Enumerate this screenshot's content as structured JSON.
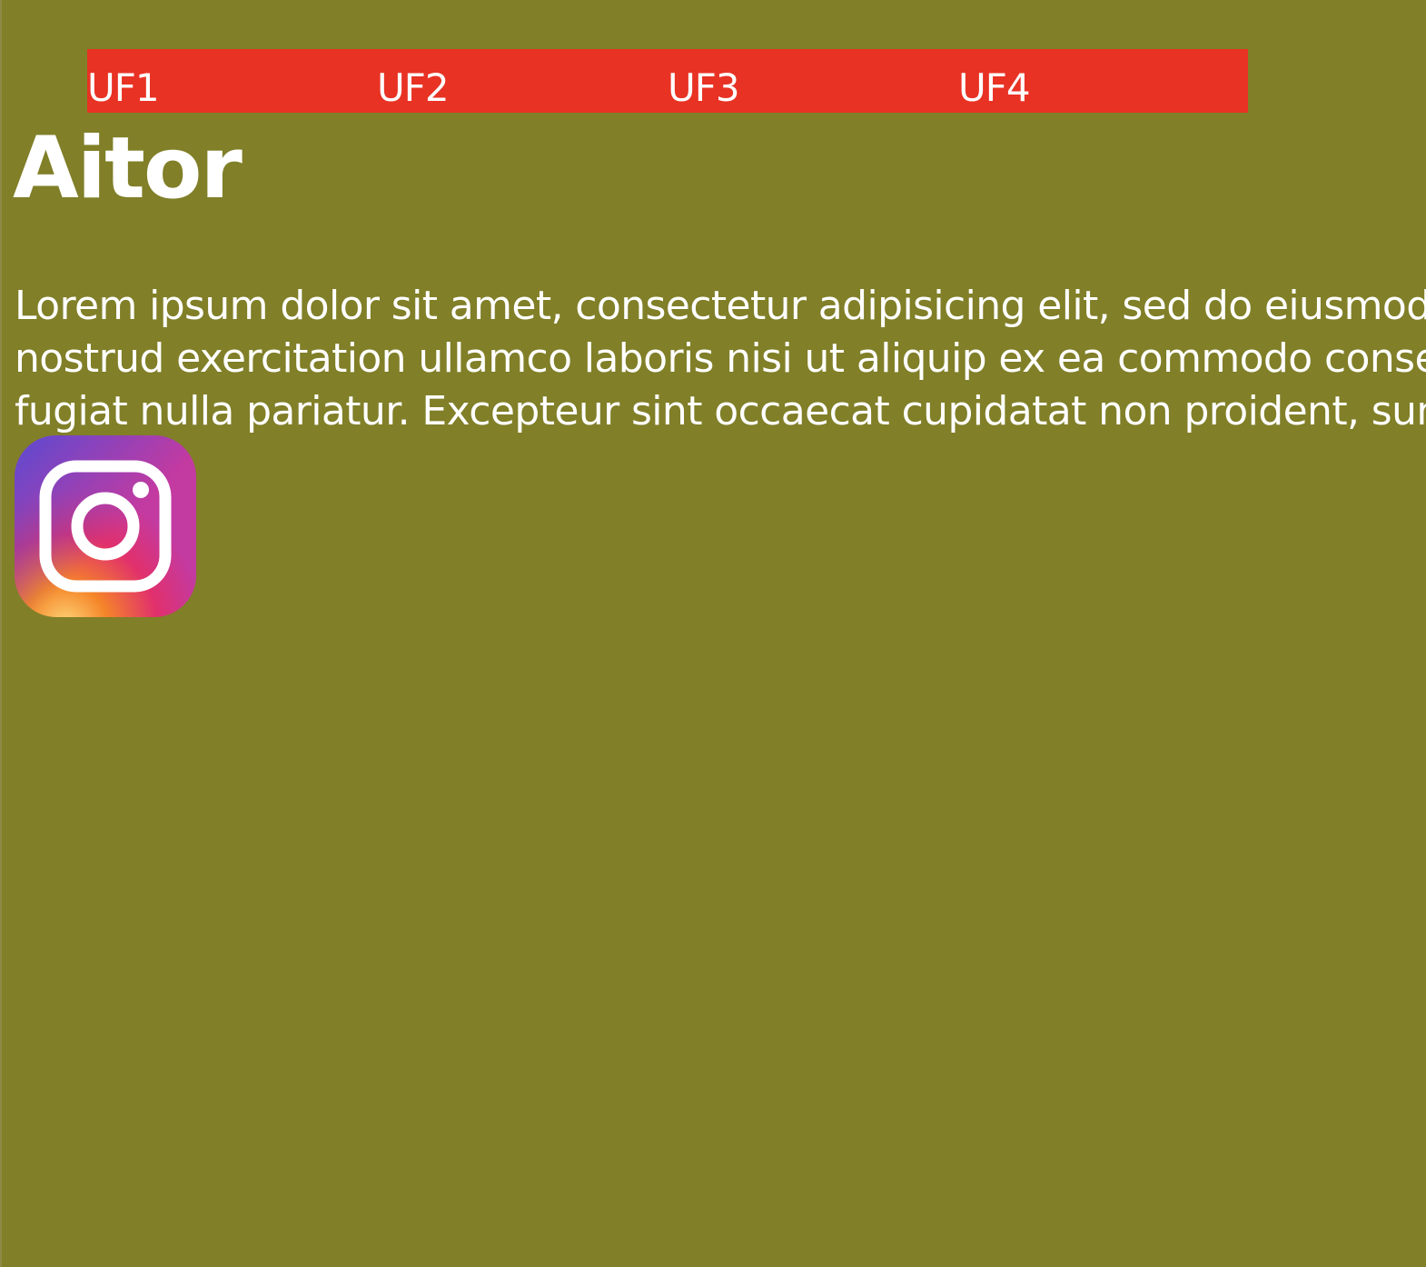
{
  "nav": {
    "items": [
      {
        "label": "UF1"
      },
      {
        "label": "UF2"
      },
      {
        "label": "UF3"
      },
      {
        "label": "UF4"
      }
    ]
  },
  "main": {
    "title": "Aitor",
    "paragraph": {
      "lines": [
        "Lorem ipsum dolor sit amet, consectetur adipisicing elit, sed do eiusmod t",
        "nostrud exercitation ullamco laboris nisi ut aliquip ex ea commodo consec",
        "fugiat nulla pariatur. Excepteur sint occaecat cupidatat non proident, sunt"
      ]
    }
  },
  "social": {
    "icon": "instagram-icon",
    "colors": {
      "violet": "#5b4ad2",
      "magenta": "#c33aa0",
      "pink": "#e1306c",
      "orange": "#f58529",
      "yellow": "#fdd87a"
    }
  },
  "colors": {
    "background": "#817f28",
    "nav_background": "#e83224",
    "text": "#ffffff"
  }
}
